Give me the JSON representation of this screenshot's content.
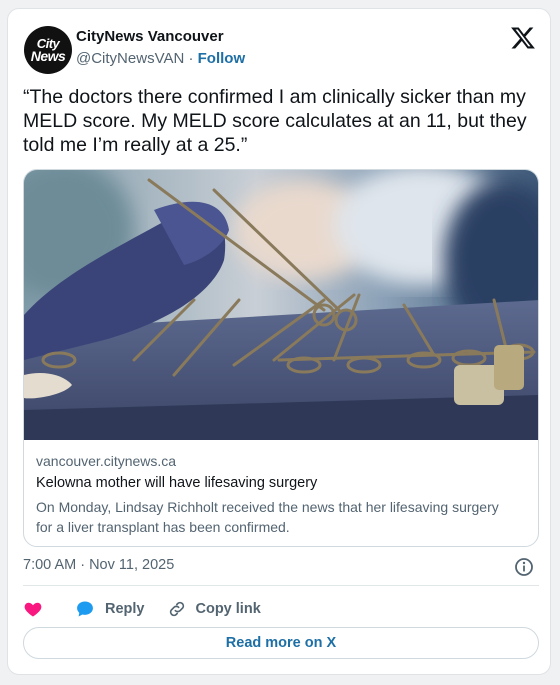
{
  "account": {
    "avatar_line1": "City",
    "avatar_line2": "News",
    "name": "CityNews Vancouver",
    "handle": "@CityNewsVAN",
    "separator": "·",
    "follow_label": "Follow"
  },
  "tweet": {
    "text": "“The doctors there confirmed I am clinically sicker than my MELD score. My MELD score calculates at an 11, but they told me I’m really at a 25.”"
  },
  "link_card": {
    "domain": "vancouver.citynews.ca",
    "title": "Kelowna mother will have lifesaving surgery",
    "description": "On Monday, Lindsay Richholt received the news that her lifesaving surgery for a liver transplant has been confirmed."
  },
  "meta": {
    "timestamp": "7:00 AM · Nov 11, 2025"
  },
  "actions": {
    "reply_label": "Reply",
    "copy_link_label": "Copy link",
    "read_more_label": "Read more on X"
  },
  "icons": {
    "logo": "x-logo-icon",
    "info": "info-icon",
    "like": "heart-icon",
    "reply": "speech-bubble-icon",
    "copy": "link-icon"
  },
  "colors": {
    "link": "#1d6fa5",
    "heart": "#f91880",
    "reply": "#1d9bf0",
    "muted": "#536471"
  }
}
